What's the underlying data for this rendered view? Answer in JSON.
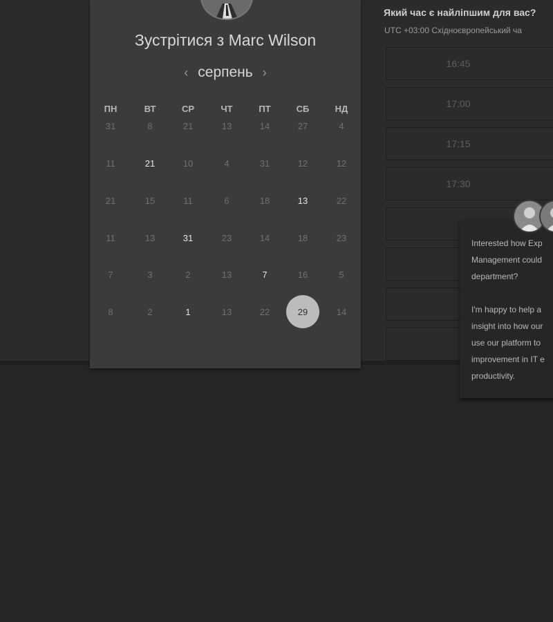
{
  "booking": {
    "title": "Зустрітися з Marc Wilson",
    "month": "серпень",
    "prev_arrow": "‹",
    "next_arrow": "›",
    "weekdays": [
      "ПН",
      "ВТ",
      "СР",
      "ЧТ",
      "ПТ",
      "СБ",
      "НД"
    ],
    "days": [
      [
        "31",
        "8",
        "21",
        "13",
        "14",
        "27",
        "4"
      ],
      [
        "11",
        "21",
        "10",
        "4",
        "31",
        "12",
        "12"
      ],
      [
        "21",
        "15",
        "11",
        "6",
        "18",
        "13",
        "22"
      ],
      [
        "11",
        "13",
        "31",
        "23",
        "14",
        "18",
        "23"
      ],
      [
        "7",
        "3",
        "2",
        "13",
        "7",
        "16",
        "5"
      ],
      [
        "8",
        "2",
        "1",
        "13",
        "22",
        "29",
        "14"
      ]
    ],
    "available": [
      [
        1,
        1
      ],
      [
        2,
        5
      ],
      [
        3,
        2
      ],
      [
        4,
        4
      ],
      [
        5,
        2
      ]
    ],
    "selected": [
      5,
      5
    ]
  },
  "times": {
    "title": "Який час є найліпшим для вас?",
    "timezone": "UTC +03:00 Східноєвропейський ча",
    "slots": [
      "16:45",
      "17:00",
      "17:15",
      "17:30",
      "",
      "",
      "",
      ""
    ]
  },
  "chat": {
    "message": "Interested how Exp\nManagement could\ndepartment?\n\nI'm happy to help a\ninsight into how our\nuse our platform to\nimprovement in IT e\nproductivity."
  }
}
